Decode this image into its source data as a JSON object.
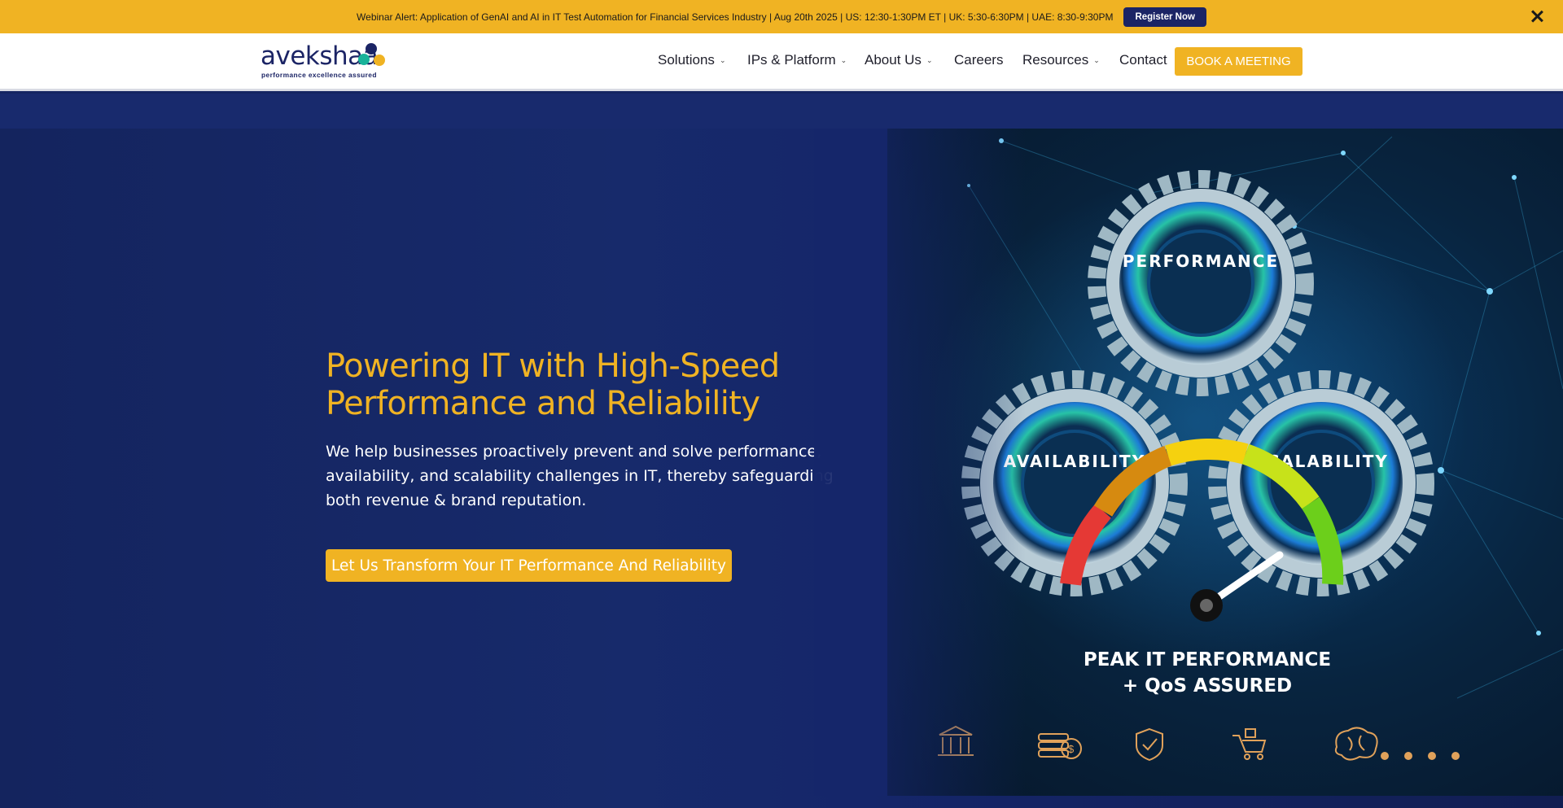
{
  "alert": {
    "text": "Webinar Alert: Application of GenAI and AI in IT Test Automation for Financial Services Industry | Aug 20th 2025 | US: 12:30-1:30PM ET | UK: 5:30-6:30PM | UAE: 8:30-9:30PM",
    "button_label": "Register Now",
    "close_icon": "close-icon"
  },
  "header": {
    "logo_word": "avekshaa",
    "logo_tagline": "performance excellence assured",
    "nav": [
      {
        "label": "Solutions",
        "has_dropdown": true
      },
      {
        "label": "IPs & Platform",
        "has_dropdown": true
      },
      {
        "label": "About Us",
        "has_dropdown": true
      },
      {
        "label": "Careers",
        "has_dropdown": false
      },
      {
        "label": "Resources",
        "has_dropdown": true
      },
      {
        "label": "Contact",
        "has_dropdown": false
      }
    ],
    "caret": "⌄",
    "book_label": "BOOK A MEETING"
  },
  "hero": {
    "title": "Powering IT with High-Speed Performance and Reliability",
    "description": "We help businesses proactively prevent and solve performance, availability, and scalability challenges in IT, thereby safeguarding both revenue & brand reputation.",
    "cta_label": "Let Us Transform Your IT Performance And Reliability",
    "image": {
      "gears": [
        "PERFORMANCE",
        "AVAILABILITY",
        "SCALABILITY"
      ],
      "tagline_line1": "PEAK IT PERFORMANCE",
      "tagline_line2": "+ QoS ASSURED",
      "industry_icons": [
        "bank-icon",
        "coins-dollar-icon",
        "shield-check-icon",
        "shopping-cart-icon",
        "brain-icon"
      ]
    }
  },
  "colors": {
    "accent_yellow": "#f0b323",
    "navy": "#1b2465",
    "hero_bg": "#142562"
  }
}
